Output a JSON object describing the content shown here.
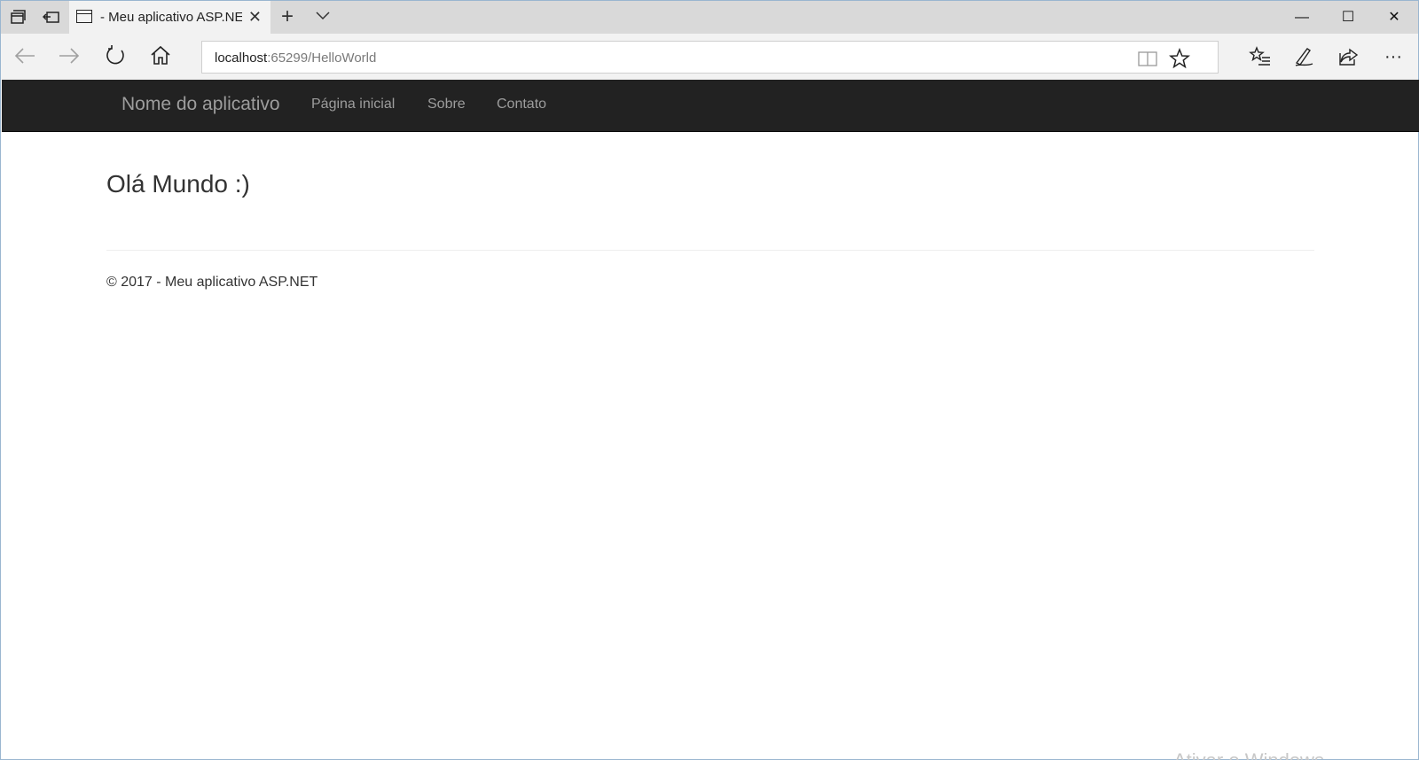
{
  "browser": {
    "tab_title": "- Meu aplicativo ASP.NE",
    "url_host": "localhost",
    "url_path": ":65299/HelloWorld",
    "window_controls": {
      "minimize": "—",
      "maximize": "☐",
      "close": "✕"
    }
  },
  "site": {
    "brand": "Nome do aplicativo",
    "nav_links": [
      "Página inicial",
      "Sobre",
      "Contato"
    ],
    "heading": "Olá Mundo :)",
    "footer": "© 2017 - Meu aplicativo ASP.NET"
  },
  "watermark": "Ativar o Windows",
  "colors": {
    "navbar_bg": "#222222",
    "navbar_text": "#9d9d9d",
    "chrome_bg": "#f2f2f2",
    "titlebar_bg": "#d9d9d9"
  }
}
